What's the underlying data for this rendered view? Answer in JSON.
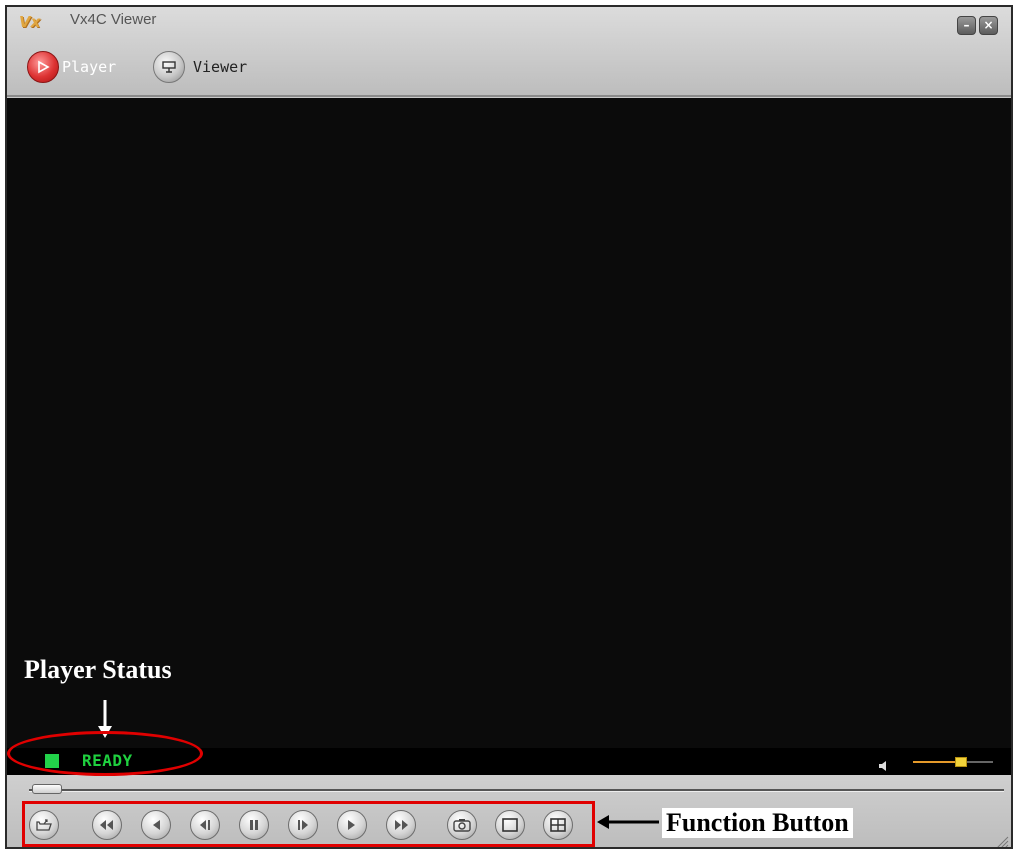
{
  "window": {
    "title": "Vx4C Viewer",
    "logo_text": "Vx",
    "minimize_symbol": "–",
    "close_symbol": "×"
  },
  "modes": [
    {
      "label": "Player",
      "icon": "play-icon",
      "active": true
    },
    {
      "label": "Viewer",
      "icon": "display-icon",
      "active": false
    }
  ],
  "status": {
    "text": "READY",
    "indicator_color": "#22d34a"
  },
  "volume": {
    "icon": "speaker-icon",
    "level": 0.6
  },
  "seek": {
    "position": 0.0
  },
  "controls": [
    {
      "name": "open-file-button",
      "icon": "open-folder-icon"
    },
    {
      "name": "fast-rewind-button",
      "icon": "fast-rewind-icon"
    },
    {
      "name": "rewind-button",
      "icon": "rewind-icon"
    },
    {
      "name": "step-backward-button",
      "icon": "step-backward-icon"
    },
    {
      "name": "pause-button",
      "icon": "pause-icon"
    },
    {
      "name": "step-forward-button",
      "icon": "step-forward-icon"
    },
    {
      "name": "play-button",
      "icon": "play-icon"
    },
    {
      "name": "fast-forward-button",
      "icon": "fast-forward-icon"
    },
    {
      "name": "snapshot-button",
      "icon": "camera-icon"
    },
    {
      "name": "single-view-button",
      "icon": "single-screen-icon"
    },
    {
      "name": "quad-view-button",
      "icon": "quad-screen-icon"
    }
  ],
  "annotations": {
    "player_status_label": "Player Status",
    "function_button_label": "Function Button"
  },
  "colors": {
    "annotation_red": "#e00000",
    "status_green": "#1fd13f",
    "volume_accent": "#e59a2a"
  }
}
